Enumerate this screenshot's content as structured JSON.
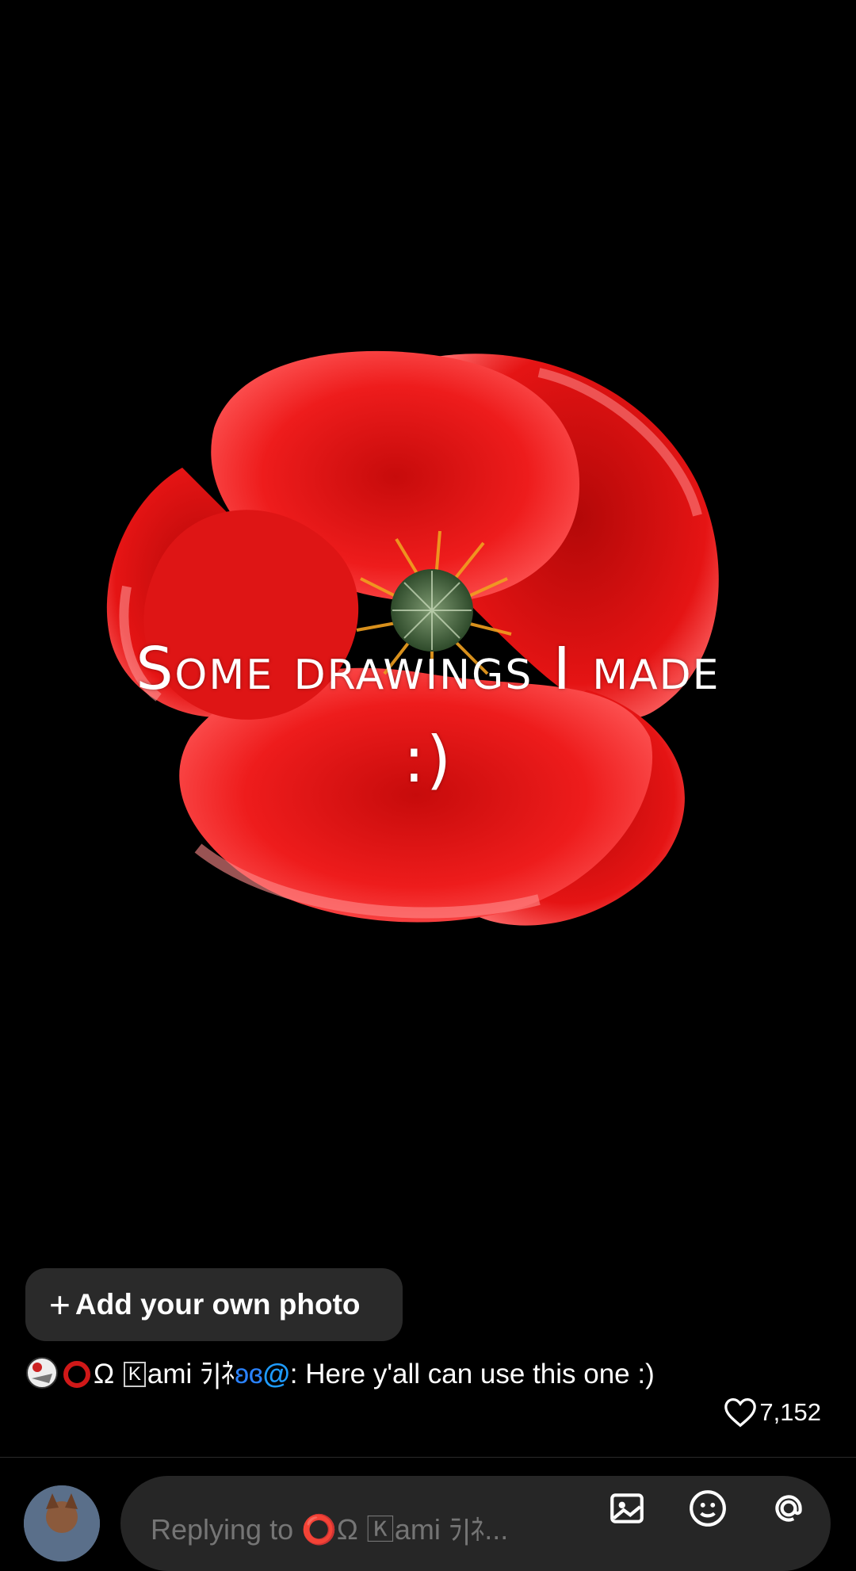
{
  "post": {
    "caption_line1": "Some drawings I made",
    "caption_line2": ":)"
  },
  "add_photo_button": {
    "icon": "plus-icon",
    "label": "Add your own photo"
  },
  "comment": {
    "author_emojis": [
      "avatar-sticker",
      "red-ring",
      "omega",
      "boxed-k",
      "butterfly",
      "swirl"
    ],
    "author_prefix": "Ω",
    "author_boxed": "K",
    "author_name": "ami ﾗ|ﾈ",
    "text": ": Here y'all can use this one :)",
    "like_count": "7,152"
  },
  "reply_bar": {
    "placeholder": "Replying to ⭕Ω 🄺ami ﾗ|ﾈ...",
    "icons": [
      "image-icon",
      "emoji-icon",
      "mention-icon"
    ]
  },
  "colors": {
    "background": "#000000",
    "poppy_red": "#e81818",
    "button_bg": "#2a2a2a",
    "input_bg": "#262626",
    "ring_red": "#d01818",
    "butterfly_blue": "#2a82ff"
  }
}
